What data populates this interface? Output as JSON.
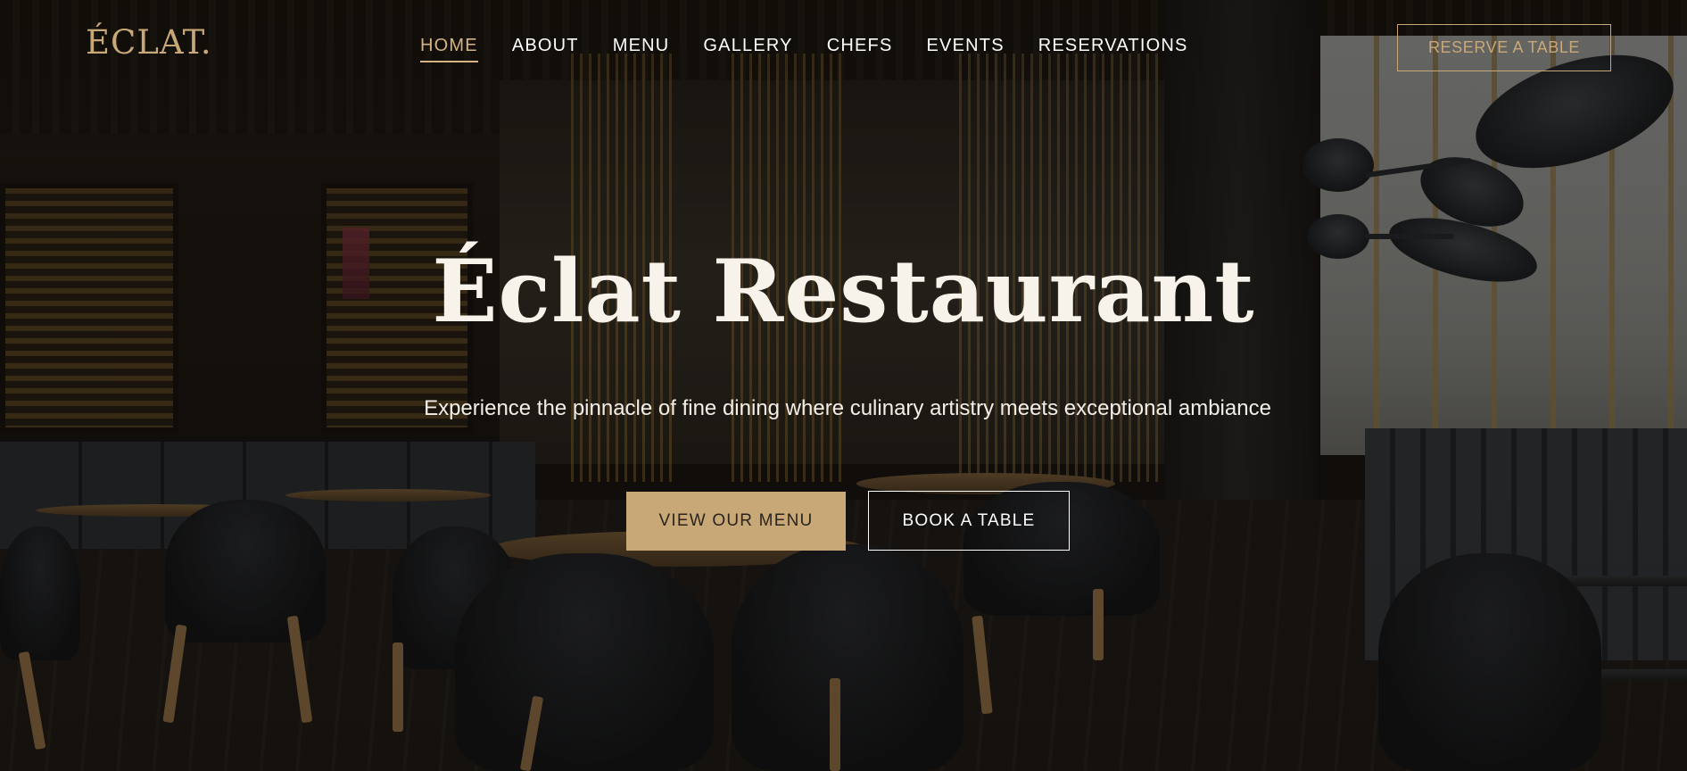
{
  "brand": {
    "logo_text": "ÉCLAT."
  },
  "nav": {
    "items": [
      {
        "label": "HOME",
        "active": true
      },
      {
        "label": "ABOUT",
        "active": false
      },
      {
        "label": "MENU",
        "active": false
      },
      {
        "label": "GALLERY",
        "active": false
      },
      {
        "label": "CHEFS",
        "active": false
      },
      {
        "label": "EVENTS",
        "active": false
      },
      {
        "label": "RESERVATIONS",
        "active": false
      }
    ],
    "cta_label": "RESERVE A TABLE"
  },
  "hero": {
    "title": "Éclat Restaurant",
    "subtitle": "Experience the pinnacle of fine dining where culinary artistry meets exceptional ambiance",
    "primary_button": "VIEW OUR MENU",
    "secondary_button": "BOOK A TABLE",
    "background": "restaurant-interior-photo"
  },
  "colors": {
    "accent_gold": "#c9a878",
    "nav_active": "#d5b382",
    "text_light": "#f7f2ea",
    "button_text_dark": "#2b241c"
  }
}
